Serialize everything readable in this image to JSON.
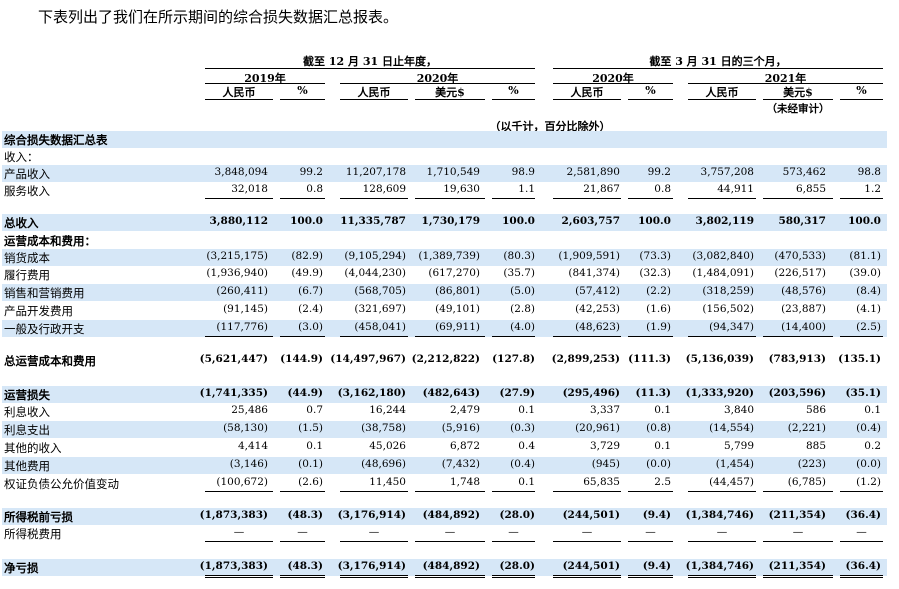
{
  "intro": "下表列出了我们在所示期间的综合损失数据汇总报表。",
  "header": {
    "period_year": "截至 12 月 31 日止年度，",
    "period_quarter": "截至 3 月 31 日的三个月，",
    "y2019": "2019年",
    "y2020a": "2020年",
    "y2020b": "2020年",
    "y2021": "2021年",
    "rmb": "人民币",
    "usd": "美元$",
    "pct": "%",
    "unaudited": "（未经审计）",
    "units": "（以千计，百分比除外）"
  },
  "rows": [
    {
      "label": "综合损失数据汇总表",
      "shaded": true,
      "bold": true,
      "values": []
    },
    {
      "label": "收入：",
      "shaded": false,
      "bold": false,
      "values": []
    },
    {
      "label": "产品收入",
      "shaded": true,
      "bold": false,
      "values": [
        "3,848,094",
        "99.2",
        "11,207,178",
        "1,710,549",
        "98.9",
        "2,581,890",
        "99.2",
        "3,757,208",
        "573,462",
        "98.8"
      ]
    },
    {
      "label": "服务收入",
      "shaded": false,
      "bold": false,
      "values": [
        "32,018",
        "0.8",
        "128,609",
        "19,630",
        "1.1",
        "21,867",
        "0.8",
        "44,911",
        "6,855",
        "1.2"
      ]
    },
    {
      "label": "总收入",
      "shaded": true,
      "bold": true,
      "values": [
        "3,880,112",
        "100.0",
        "11,335,787",
        "1,730,179",
        "100.0",
        "2,603,757",
        "100.0",
        "3,802,119",
        "580,317",
        "100.0"
      ]
    },
    {
      "label": "运营成本和费用：",
      "shaded": false,
      "bold": true,
      "values": []
    },
    {
      "label": "销货成本",
      "shaded": true,
      "bold": false,
      "values": [
        "(3,215,175)",
        "(82.9)",
        "(9,105,294)",
        "(1,389,739)",
        "(80.3)",
        "(1,909,591)",
        "(73.3)",
        "(3,082,840)",
        "(470,533)",
        "(81.1)"
      ]
    },
    {
      "label": "履行费用",
      "shaded": false,
      "bold": false,
      "values": [
        "(1,936,940)",
        "(49.9)",
        "(4,044,230)",
        "(617,270)",
        "(35.7)",
        "(841,374)",
        "(32.3)",
        "(1,484,091)",
        "(226,517)",
        "(39.0)"
      ]
    },
    {
      "label": "销售和营销费用",
      "shaded": true,
      "bold": false,
      "values": [
        "(260,411)",
        "(6.7)",
        "(568,705)",
        "(86,801)",
        "(5.0)",
        "(57,412)",
        "(2.2)",
        "(318,259)",
        "(48,576)",
        "(8.4)"
      ]
    },
    {
      "label": "产品开发费用",
      "shaded": false,
      "bold": false,
      "values": [
        "(91,145)",
        "(2.4)",
        "(321,697)",
        "(49,101)",
        "(2.8)",
        "(42,253)",
        "(1.6)",
        "(156,502)",
        "(23,887)",
        "(4.1)"
      ]
    },
    {
      "label": "一般及行政开支",
      "shaded": true,
      "bold": false,
      "values": [
        "(117,776)",
        "(3.0)",
        "(458,041)",
        "(69,911)",
        "(4.0)",
        "(48,623)",
        "(1.9)",
        "(94,347)",
        "(14,400)",
        "(2.5)"
      ]
    },
    {
      "label": "总运营成本和费用",
      "shaded": false,
      "bold": true,
      "values": [
        "(5,621,447)",
        "(144.9)",
        "(14,497,967)",
        "(2,212,822)",
        "(127.8)",
        "(2,899,253)",
        "(111.3)",
        "(5,136,039)",
        "(783,913)",
        "(135.1)"
      ]
    },
    {
      "label": "运营损失",
      "shaded": true,
      "bold": true,
      "values": [
        "(1,741,335)",
        "(44.9)",
        "(3,162,180)",
        "(482,643)",
        "(27.9)",
        "(295,496)",
        "(11.3)",
        "(1,333,920)",
        "(203,596)",
        "(35.1)"
      ]
    },
    {
      "label": "利息收入",
      "shaded": false,
      "bold": false,
      "values": [
        "25,486",
        "0.7",
        "16,244",
        "2,479",
        "0.1",
        "3,337",
        "0.1",
        "3,840",
        "586",
        "0.1"
      ]
    },
    {
      "label": "利息支出",
      "shaded": true,
      "bold": false,
      "values": [
        "(58,130)",
        "(1.5)",
        "(38,758)",
        "(5,916)",
        "(0.3)",
        "(20,961)",
        "(0.8)",
        "(14,554)",
        "(2,221)",
        "(0.4)"
      ]
    },
    {
      "label": "其他的收入",
      "shaded": false,
      "bold": false,
      "values": [
        "4,414",
        "0.1",
        "45,026",
        "6,872",
        "0.4",
        "3,729",
        "0.1",
        "5,799",
        "885",
        "0.2"
      ]
    },
    {
      "label": "其他费用",
      "shaded": true,
      "bold": false,
      "values": [
        "(3,146)",
        "(0.1)",
        "(48,696)",
        "(7,432)",
        "(0.4)",
        "(945)",
        "(0.0)",
        "(1,454)",
        "(223)",
        "(0.0)"
      ]
    },
    {
      "label": "权证负债公允价值变动",
      "shaded": false,
      "bold": false,
      "values": [
        "(100,672)",
        "(2.6)",
        "11,450",
        "1,748",
        "0.1",
        "65,835",
        "2.5",
        "(44,457)",
        "(6,785)",
        "(1.2)"
      ]
    },
    {
      "label": "所得税前亏损",
      "shaded": true,
      "bold": true,
      "values": [
        "(1,873,383)",
        "(48.3)",
        "(3,176,914)",
        "(484,892)",
        "(28.0)",
        "(244,501)",
        "(9.4)",
        "(1,384,746)",
        "(211,354)",
        "(36.4)"
      ]
    },
    {
      "label": "所得税费用",
      "shaded": false,
      "bold": false,
      "values": [
        "—",
        "—",
        "—",
        "—",
        "—",
        "—",
        "—",
        "—",
        "—",
        "—"
      ]
    },
    {
      "label": "净亏损",
      "shaded": true,
      "bold": true,
      "values": [
        "(1,873,383)",
        "(48.3)",
        "(3,176,914)",
        "(484,892)",
        "(28.0)",
        "(244,501)",
        "(9.4)",
        "(1,384,746)",
        "(211,354)",
        "(36.4)"
      ]
    }
  ]
}
